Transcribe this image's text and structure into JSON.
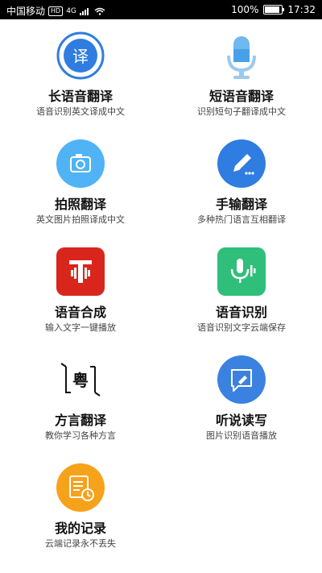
{
  "status_bar": {
    "carrier": "中国移动",
    "hd": "HD",
    "network": "4G",
    "battery": "100%",
    "time": "17:32"
  },
  "features": [
    {
      "title": "长语音翻译",
      "subtitle": "语音识别英文译成中文",
      "icon": "translate-icon"
    },
    {
      "title": "短语音翻译",
      "subtitle": "识别短句子翻译成中文",
      "icon": "microphone-icon"
    },
    {
      "title": "拍照翻译",
      "subtitle": "英文图片拍照译成中文",
      "icon": "camera-icon"
    },
    {
      "title": "手输翻译",
      "subtitle": "多种热门语言互相翻译",
      "icon": "pen-icon"
    },
    {
      "title": "语音合成",
      "subtitle": "输入文字一键播放",
      "icon": "tts-icon"
    },
    {
      "title": "语音识别",
      "subtitle": "语音识别文字云端保存",
      "icon": "voice-recognition-icon"
    },
    {
      "title": "方言翻译",
      "subtitle": "教你学习各种方言",
      "icon": "dialect-icon"
    },
    {
      "title": "听说读写",
      "subtitle": "图片识别语音播放",
      "icon": "listen-speak-icon"
    },
    {
      "title": "我的记录",
      "subtitle": "云端记录永不丢失",
      "icon": "record-icon"
    }
  ],
  "icon_text": {
    "translate": "译",
    "dialect": "粤"
  },
  "colors": {
    "blue": "#2f7de1",
    "light_blue": "#4fb3f5",
    "red": "#d9261c",
    "green": "#2fbf7a",
    "orange": "#f7a21b"
  }
}
